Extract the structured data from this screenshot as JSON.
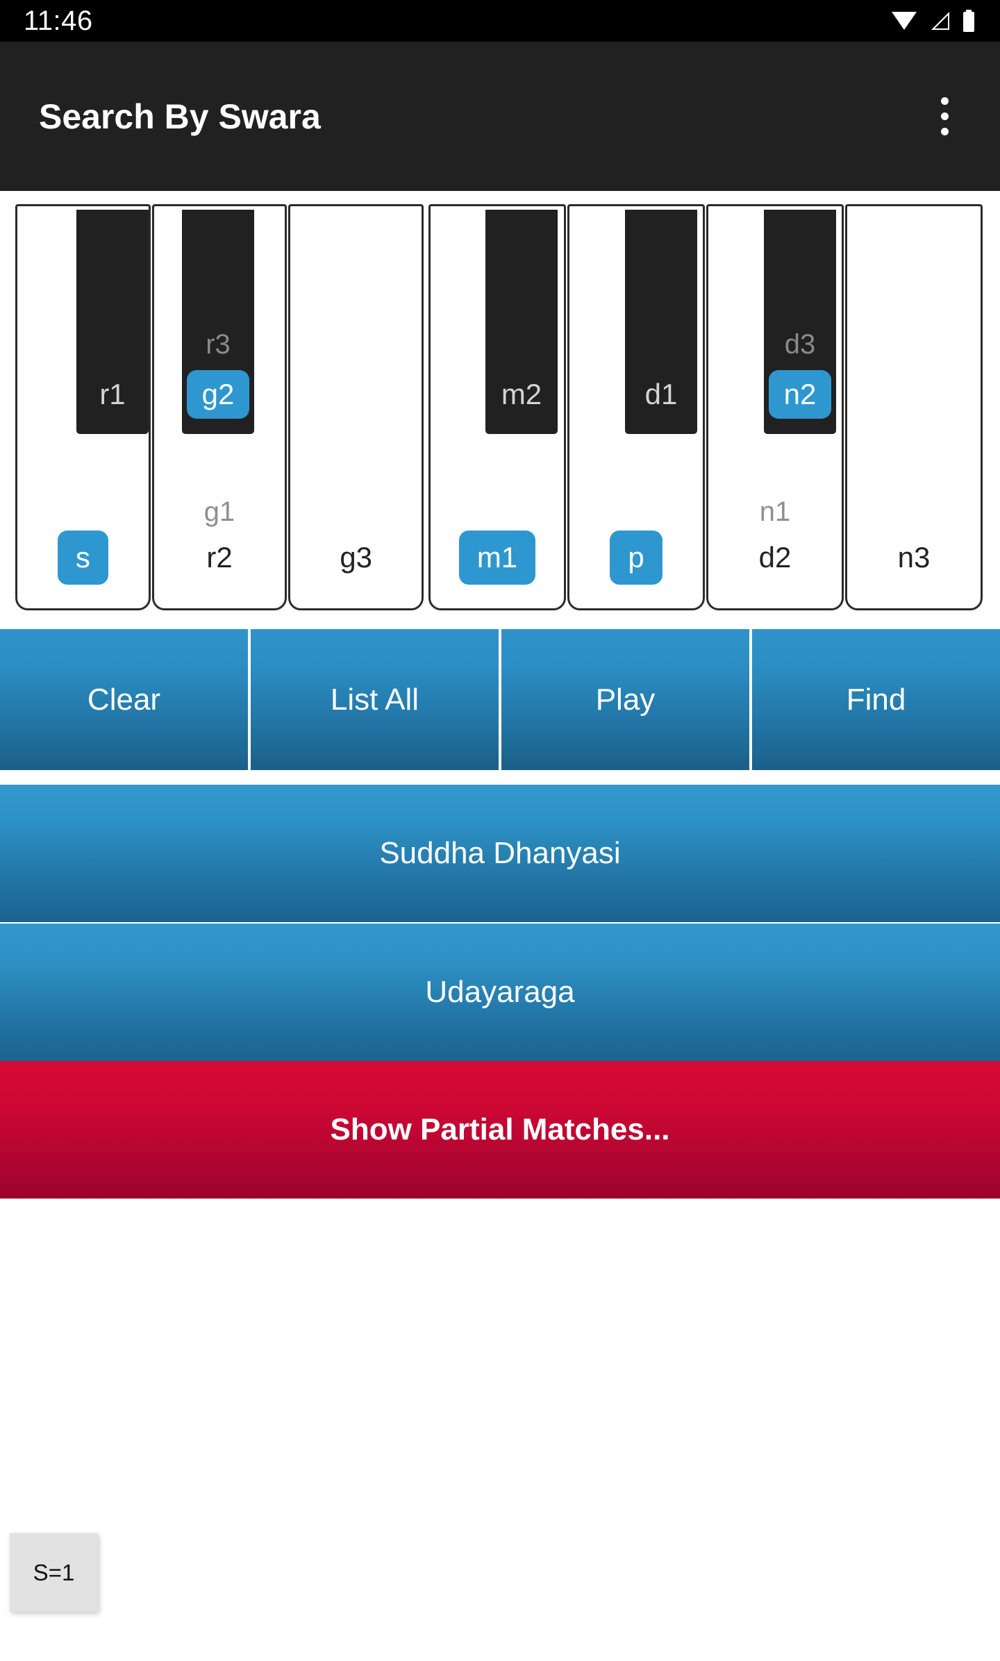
{
  "statusbar": {
    "time": "11:46",
    "icons": [
      "wifi-icon",
      "cellular-signal-icon",
      "battery-icon"
    ]
  },
  "appbar": {
    "title": "Search By Swara",
    "overflow_icon": "more-vertical-icon"
  },
  "keyboard": {
    "octaves": [
      {
        "white_keys": [
          {
            "label": "s",
            "alt": "",
            "selected": true
          },
          {
            "label": "r2",
            "alt": "g1",
            "selected": false
          },
          {
            "label": "g3",
            "alt": "",
            "selected": false
          }
        ],
        "black_keys": [
          {
            "label": "r1",
            "alt": "",
            "selected": false
          },
          {
            "label": "g2",
            "alt": "r3",
            "selected": true
          }
        ]
      },
      {
        "white_keys": [
          {
            "label": "m1",
            "alt": "",
            "selected": true
          },
          {
            "label": "p",
            "alt": "",
            "selected": true
          },
          {
            "label": "d2",
            "alt": "n1",
            "selected": false
          },
          {
            "label": "n3",
            "alt": "",
            "selected": false
          }
        ],
        "black_keys": [
          {
            "label": "m2",
            "alt": "",
            "selected": false
          },
          {
            "label": "d1",
            "alt": "",
            "selected": false
          },
          {
            "label": "n2",
            "alt": "d3",
            "selected": true
          }
        ]
      }
    ]
  },
  "actions": [
    {
      "label": "Clear"
    },
    {
      "label": "List All"
    },
    {
      "label": "Play"
    },
    {
      "label": "Find"
    }
  ],
  "results": [
    {
      "label": "Suddha Dhanyasi",
      "kind": "blue"
    },
    {
      "label": "Udayaraga",
      "kind": "blue"
    },
    {
      "label": "Show Partial Matches...",
      "kind": "red"
    }
  ],
  "toast": {
    "text": "S=1"
  },
  "colors": {
    "accent": "#2e97cf",
    "button_top": "#2f93c9",
    "button_bottom": "#1b5f88",
    "red_top": "#d70a32",
    "red_bottom": "#9b032c",
    "appbar": "#212121",
    "statusbar": "#000000",
    "alt_label": "#8f8f8f"
  }
}
